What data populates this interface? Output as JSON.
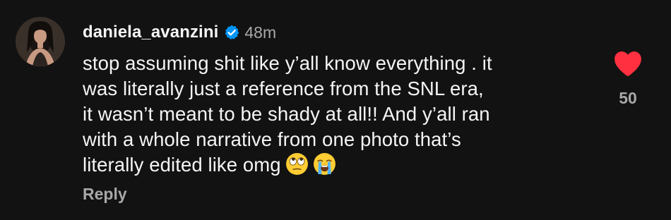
{
  "comment": {
    "username": "daniela_avanzini",
    "time_ago": "48m",
    "text_lines": [
      "stop assuming shit like y’all know everything . it",
      "was literally just a reference from the SNL era,",
      "it wasn’t meant to be shady at all!! And y’all ran",
      "with a whole narrative from one photo that’s",
      "literally edited like omg"
    ],
    "emojis": [
      "eye-roll-emoji",
      "loudly-crying-emoji"
    ],
    "reply_label": "Reply",
    "like_count": "50",
    "liked": true
  },
  "icons": {
    "verified": "verified-badge-icon",
    "like": "heart-icon"
  },
  "colors": {
    "background": "#121212",
    "text": "#f5f5f5",
    "secondary_text": "#a8a8a8",
    "verified_blue": "#0095f6",
    "like_red": "#ff3040"
  }
}
